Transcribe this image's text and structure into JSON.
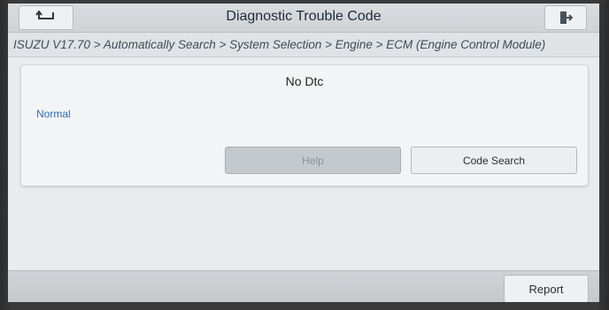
{
  "header": {
    "title": "Diagnostic Trouble Code",
    "back_icon": "back-arrow-icon",
    "exit_icon": "exit-door-icon"
  },
  "breadcrumb": {
    "path": "ISUZU V17.70 > Automatically Search > System Selection > Engine > ECM (Engine Control Module)"
  },
  "dtc_panel": {
    "message": "No Dtc",
    "status": "Normal",
    "status_color": "#2a6fc0",
    "help_label": "Help",
    "help_enabled": false,
    "code_search_label": "Code Search"
  },
  "footer": {
    "report_label": "Report"
  }
}
